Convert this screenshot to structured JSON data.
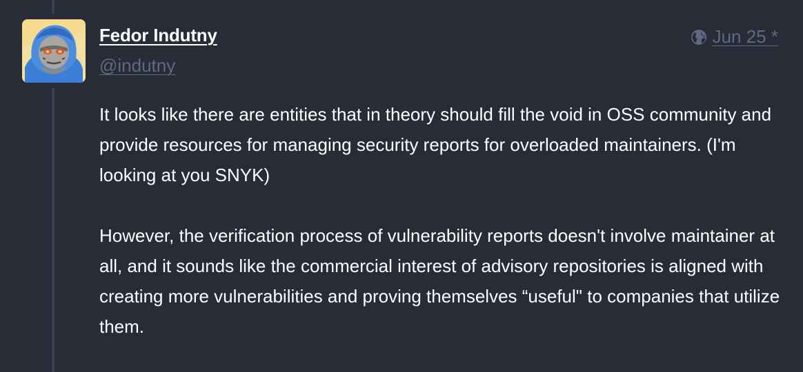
{
  "author": {
    "display_name": "Fedor Indutny",
    "handle": "@indutny",
    "avatar_icon": "avatar-illustration"
  },
  "meta": {
    "visibility_icon": "globe-icon",
    "timestamp": "Jun 25 *"
  },
  "content": {
    "paragraphs": [
      "It looks like there are entities that in theory should fill the void in OSS community and provide resources for managing security reports for overloaded maintainers. (I'm looking at you SNYK)",
      "However, the verification process of vulnerability reports doesn't involve maintainer at all, and it sounds like the commercial interest of advisory repositories is aligned with creating more vulnerabilities and proving themselves “useful\" to companies that utilize them."
    ]
  },
  "colors": {
    "background": "#282c37",
    "muted": "#606984",
    "text": "#ffffff",
    "thread_line": "#393f4f"
  }
}
